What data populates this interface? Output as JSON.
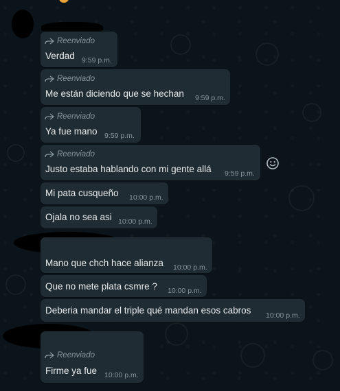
{
  "forward_label": "Reenviado",
  "messages": [
    {
      "forwarded": true,
      "text": "Verdad",
      "time": "9:59 p.m."
    },
    {
      "forwarded": true,
      "text": "Me están diciendo que se hechan",
      "time": "9:59 p.m."
    },
    {
      "forwarded": true,
      "text": "Ya fue mano",
      "time": "9:59 p.m."
    },
    {
      "forwarded": true,
      "text": "Justo estaba hablando con mi gente allá",
      "time": "9:59 p.m."
    },
    {
      "forwarded": false,
      "text": "Mi pata cusqueño",
      "time": "10:00 p.m."
    },
    {
      "forwarded": false,
      "text": "Ojala no sea asi",
      "time": "10:00 p.m."
    },
    {
      "forwarded": false,
      "text": "Mano que chch hace alianza",
      "time": "10:00 p.m."
    },
    {
      "forwarded": false,
      "text": "Que no mete plata csmre ?",
      "time": "10:00 p.m."
    },
    {
      "forwarded": false,
      "text": "Deberia mandar el triple qué mandan esos cabros",
      "time": "10:00 p.m."
    },
    {
      "forwarded": true,
      "text": "Firme ya fue",
      "time": "10:00 p.m."
    }
  ],
  "icons": {
    "forward": "forward-arrow-icon",
    "emoji": "emoji-smiley-icon"
  },
  "colors": {
    "background": "#0b141a",
    "bubble": "#202c33",
    "meta_text": "#8696a0",
    "message_text": "#e9edef"
  }
}
